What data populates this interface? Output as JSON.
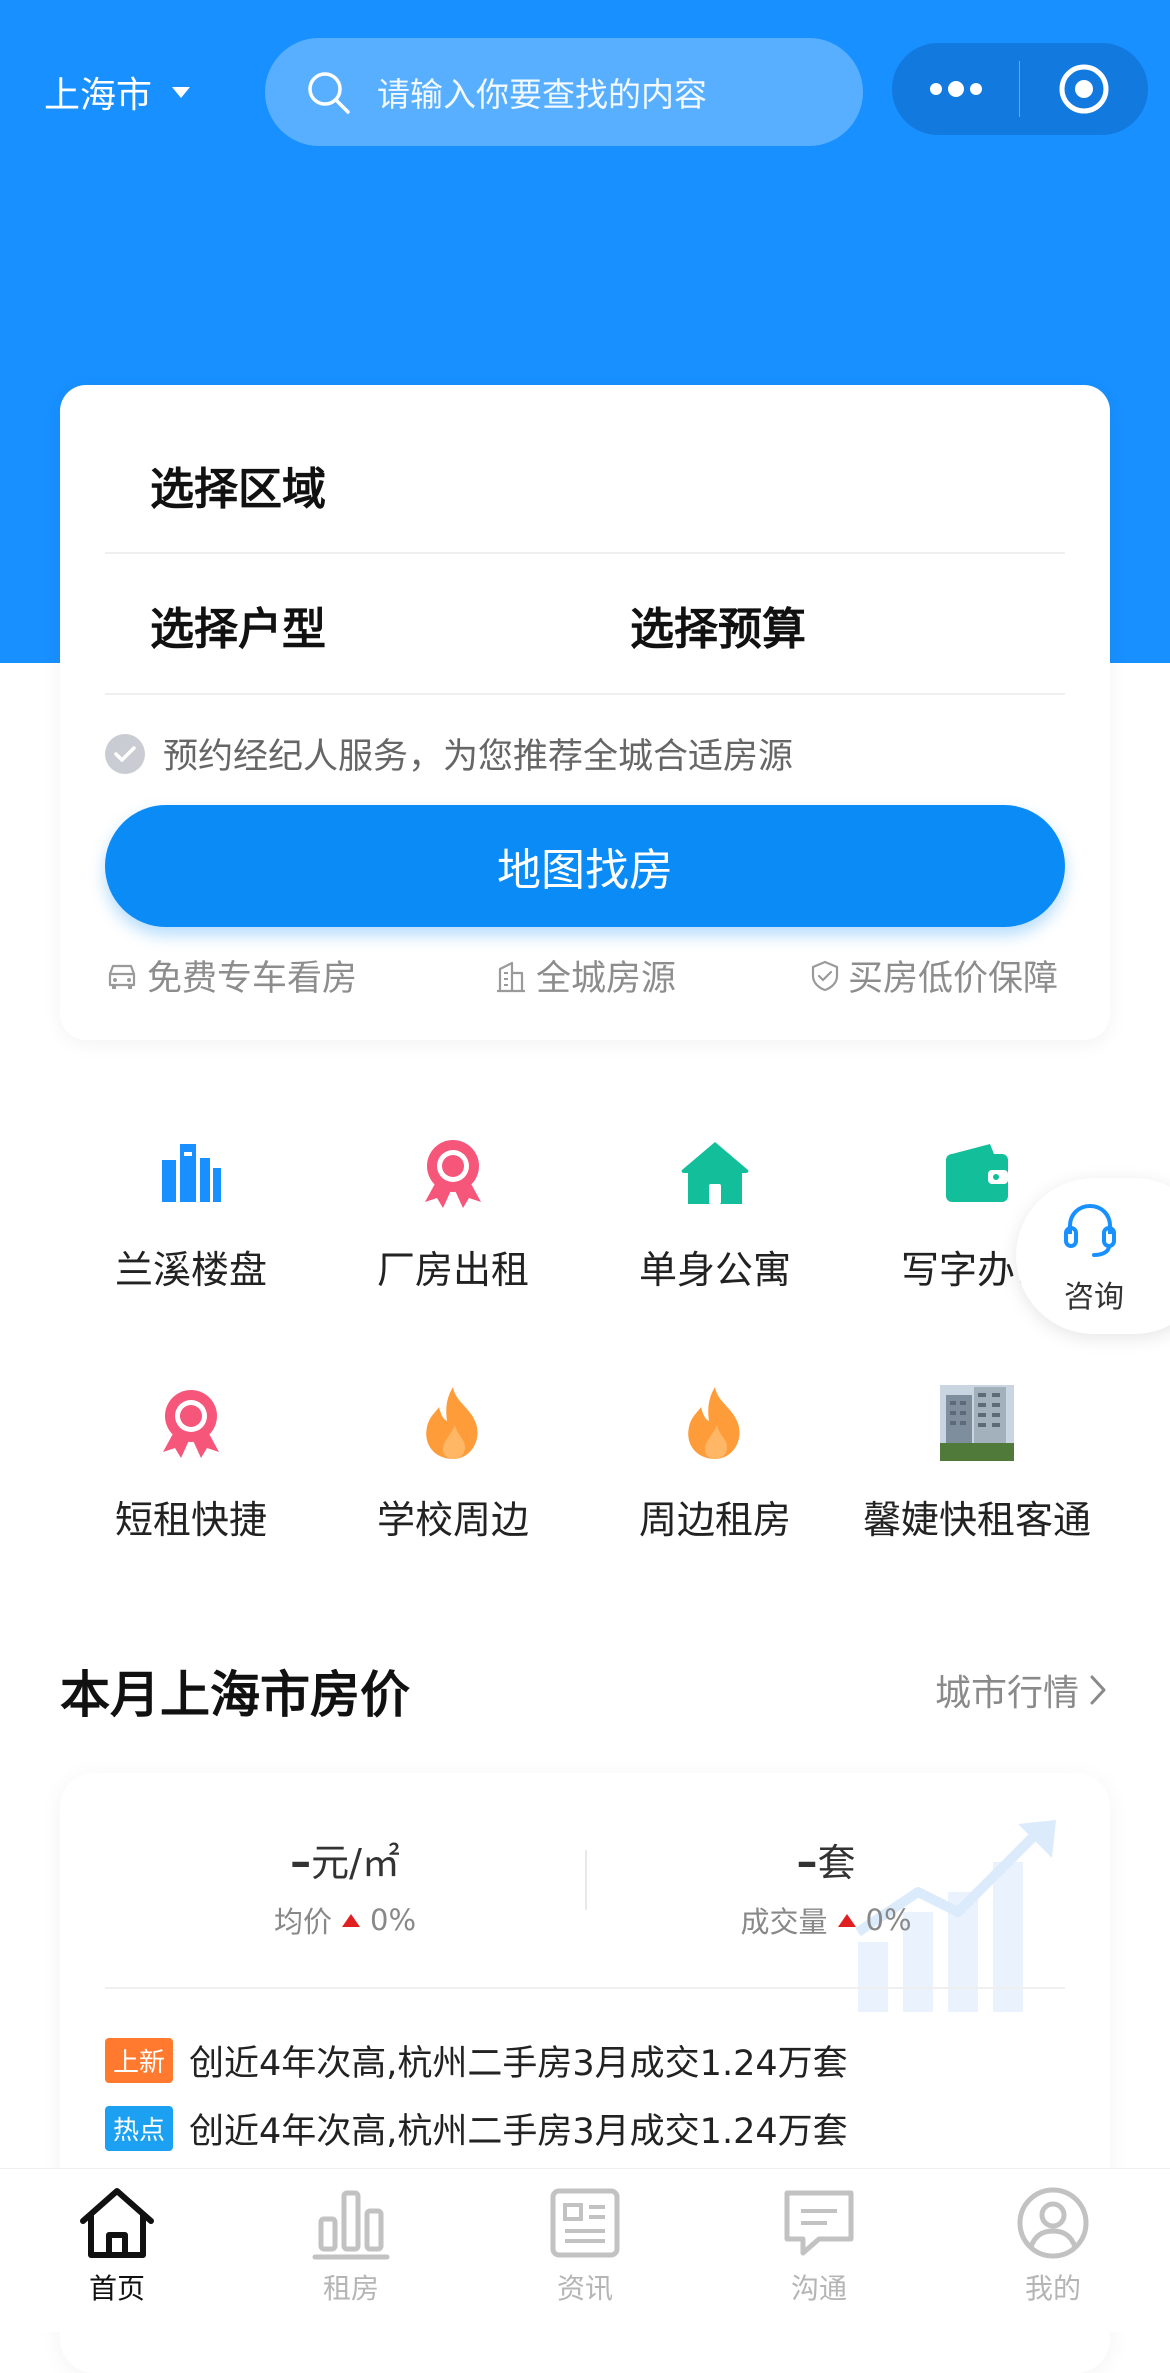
{
  "header": {
    "city": "上海市",
    "search_placeholder": "请输入你要查找的内容"
  },
  "filter_card": {
    "area_label": "选择区域",
    "room_label": "选择户型",
    "budget_label": "选择预算",
    "note": "预约经纪人服务，为您推荐全城合适房源",
    "map_button": "地图找房",
    "features": [
      "免费专车看房",
      "全城房源",
      "买房低价保障"
    ]
  },
  "categories": [
    {
      "label": "兰溪楼盘",
      "icon": "building-icon",
      "color": "#1890FF"
    },
    {
      "label": "厂房出租",
      "icon": "ribbon-badge-icon",
      "color": "#F5567A"
    },
    {
      "label": "单身公寓",
      "icon": "house-icon",
      "color": "#13BF9A"
    },
    {
      "label": "写字办公",
      "icon": "wallet-icon",
      "color": "#13BF9A"
    },
    {
      "label": "短租快捷",
      "icon": "ribbon-badge-icon",
      "color": "#F5567A"
    },
    {
      "label": "学校周边",
      "icon": "flame-icon",
      "color": "#FF9C3A"
    },
    {
      "label": "周边租房",
      "icon": "flame-icon",
      "color": "#FF9C3A"
    },
    {
      "label": "馨婕快租客通",
      "icon": "building-photo-icon",
      "color": "#8a9bab"
    }
  ],
  "consult": {
    "label": "咨询"
  },
  "price_section": {
    "title": "本月上海市房价",
    "more": "城市行情",
    "avg_value": "–",
    "avg_unit": "元/㎡",
    "avg_label": "均价",
    "avg_change": "0%",
    "volume_value": "–",
    "volume_unit": "套",
    "volume_label": "成交量",
    "volume_change": "0%",
    "news": [
      {
        "tag": "上新",
        "tag_color": "#FF7A2F",
        "text": "创近4年次高,杭州二手房3月成交1.24万套"
      },
      {
        "tag": "热点",
        "tag_color": "#1BA0F2",
        "text": "创近4年次高,杭州二手房3月成交1.24万套"
      }
    ]
  },
  "tabbar": [
    {
      "label": "首页",
      "icon": "home-icon",
      "active": true
    },
    {
      "label": "租房",
      "icon": "bar-chart-icon",
      "active": false
    },
    {
      "label": "资讯",
      "icon": "news-icon",
      "active": false
    },
    {
      "label": "沟通",
      "icon": "chat-icon",
      "active": false
    },
    {
      "label": "我的",
      "icon": "user-icon",
      "active": false
    }
  ],
  "colors": {
    "primary": "#1890FF",
    "button": "#0A8BF6",
    "rise": "#E02020"
  }
}
